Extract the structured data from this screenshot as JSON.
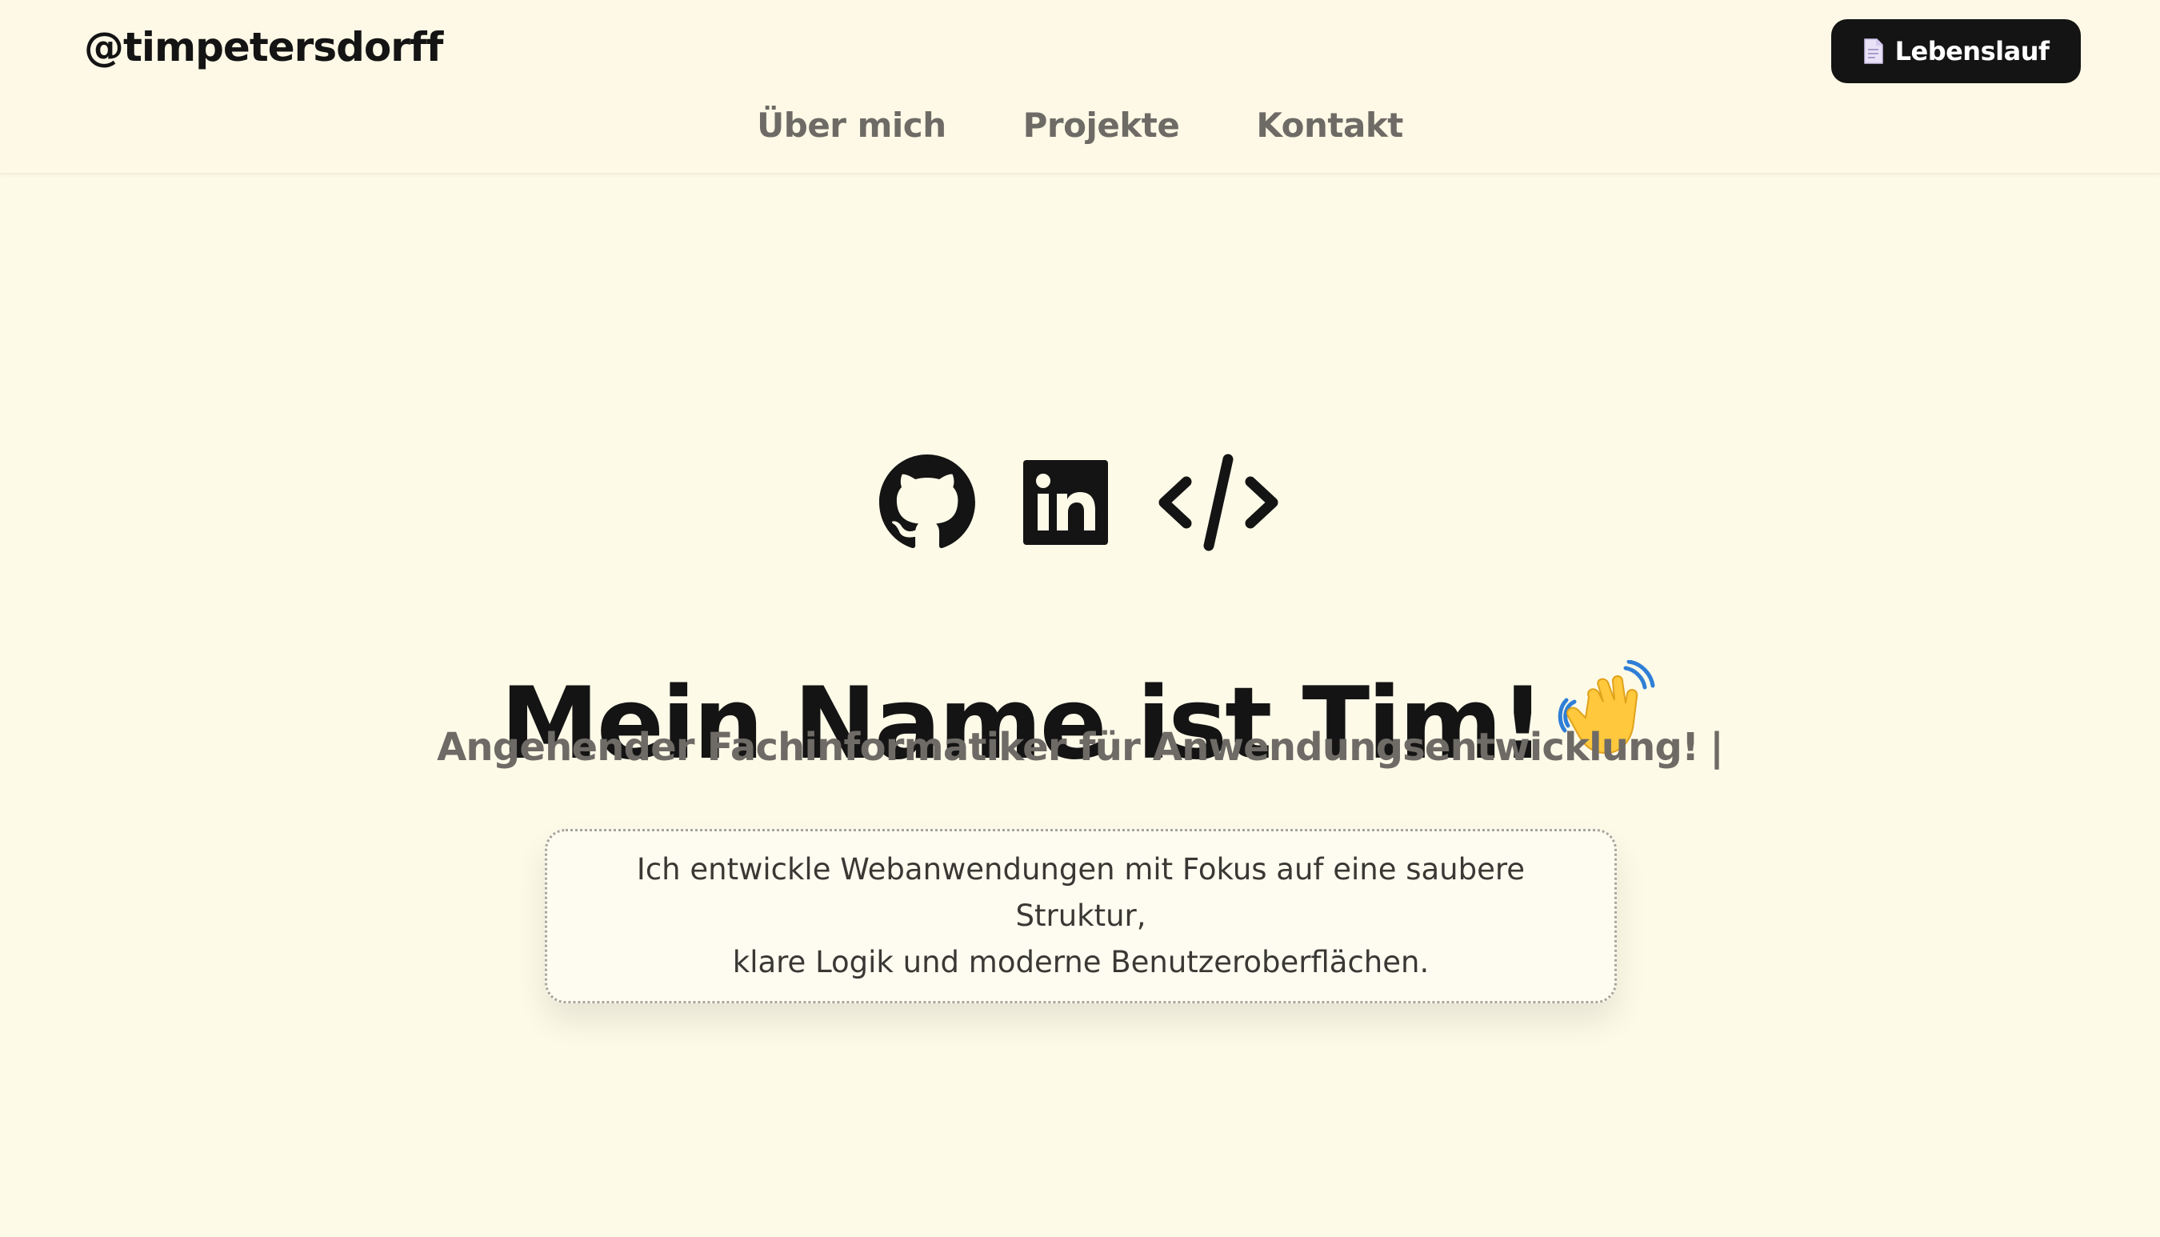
{
  "header": {
    "brand": "@timpetersdorff",
    "cv_button_label": "Lebenslauf",
    "cv_button_icon": "document-icon"
  },
  "nav": {
    "items": [
      {
        "label": "Über mich"
      },
      {
        "label": "Projekte"
      },
      {
        "label": "Kontakt"
      }
    ]
  },
  "social": {
    "icons": [
      "github-icon",
      "linkedin-icon",
      "code-icon"
    ]
  },
  "hero": {
    "headline": "Mein Name ist Tim!",
    "headline_emoji": "waving-hand-icon",
    "subtitle": "Angehender Fachinformatiker für Anwendungsentwicklung!",
    "cursor": "|",
    "intro_line1": "Ich entwickle Webanwendungen mit Fokus auf eine saubere Struktur,",
    "intro_line2": "klare Logik und moderne Benutzeroberflächen."
  },
  "colors": {
    "background": "#fefae8",
    "text": "#141414",
    "muted": "#6e6b66",
    "button": "#141414"
  }
}
